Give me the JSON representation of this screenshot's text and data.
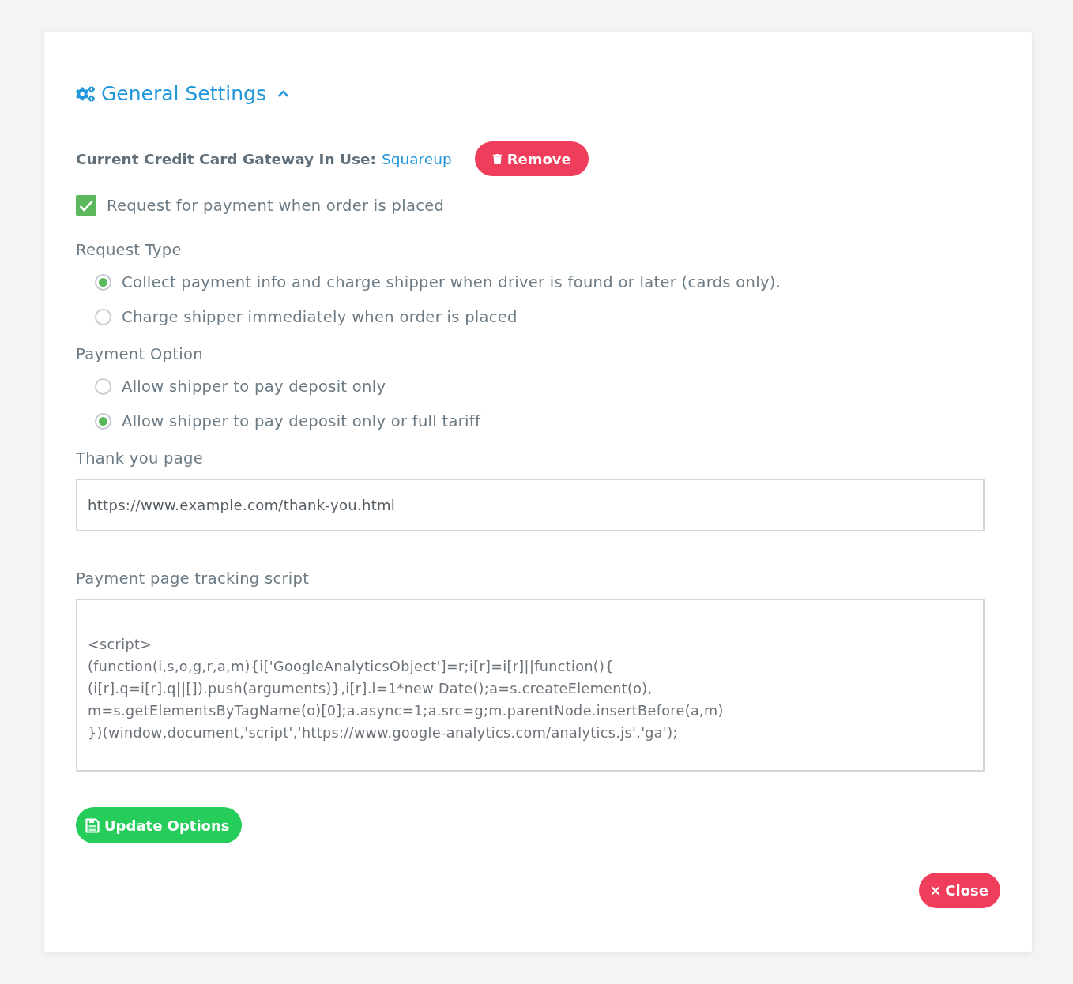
{
  "section": {
    "title": "General Settings",
    "expanded": true
  },
  "gateway": {
    "label": "Current Credit Card Gateway In Use:",
    "value": "Squareup",
    "button": "Remove"
  },
  "request_payment": {
    "label": "Request for payment when order is placed",
    "checked": true
  },
  "request_type": {
    "label": "Request Type",
    "options": [
      {
        "label": "Collect payment info and charge shipper when driver is found or later (cards only).",
        "selected": true
      },
      {
        "label": "Charge shipper immediately when order is placed",
        "selected": false
      }
    ]
  },
  "payment_option": {
    "label": "Payment Option",
    "options": [
      {
        "label": "Allow shipper to pay deposit only",
        "selected": false
      },
      {
        "label": "Allow shipper to pay deposit only or full tariff",
        "selected": true
      }
    ]
  },
  "thank_you_page": {
    "label": "Thank you page",
    "value": "https://www.example.com/thank-you.html"
  },
  "tracking_script": {
    "label": "Payment page tracking script",
    "lines": [
      "<script>",
      "(function(i,s,o,g,r,a,m){i['GoogleAnalyticsObject']=r;i[r]=i[r]||function(){",
      "(i[r].q=i[r].q||[]).push(arguments)},i[r].l=1*new Date();a=s.createElement(o),",
      "m=s.getElementsByTagName(o)[0];a.async=1;a.src=g;m.parentNode.insertBefore(a,m)",
      "})(window,document,'script','https://www.google-analytics.com/analytics.js','ga');"
    ]
  },
  "buttons": {
    "update": "Update Options",
    "close": "Close"
  }
}
